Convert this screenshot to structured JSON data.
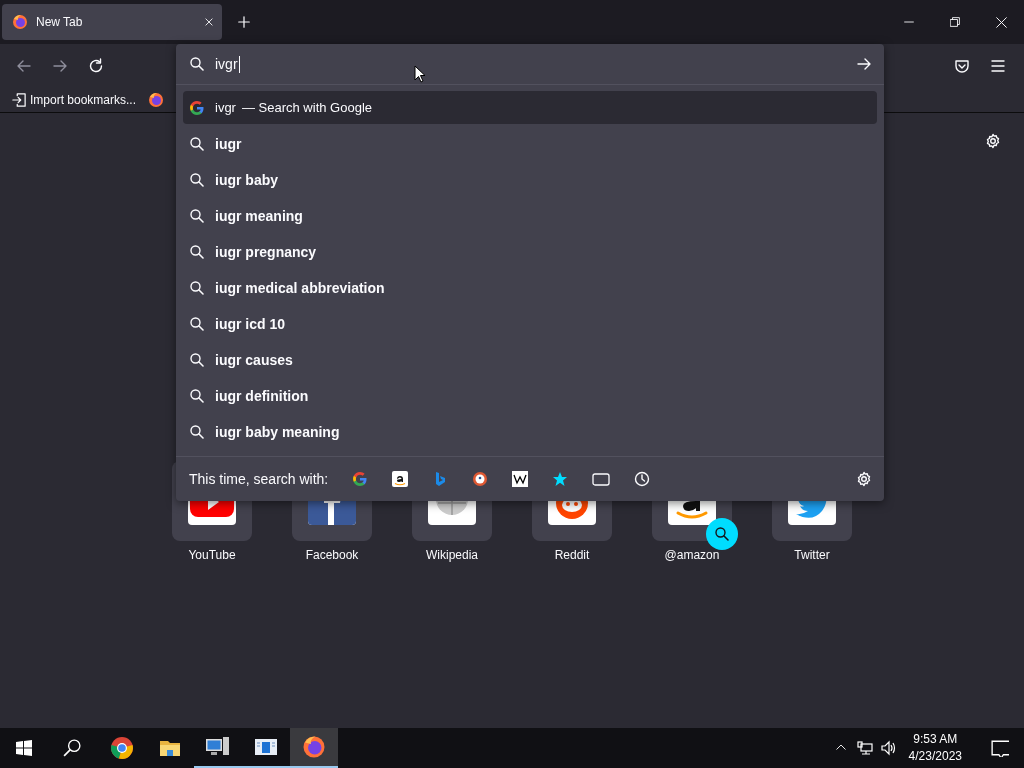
{
  "tab": {
    "title": "New Tab",
    "selected": true
  },
  "bookmarks": [
    {
      "label": "Import bookmarks..."
    }
  ],
  "urlbar": {
    "value": "ivgr"
  },
  "results": [
    {
      "kind": "engine",
      "query": "ivgr",
      "action": "— Search with Google",
      "selected": true
    },
    {
      "kind": "suggestion",
      "text": "iugr",
      "selected": false
    },
    {
      "kind": "suggestion",
      "text": "iugr baby",
      "selected": false
    },
    {
      "kind": "suggestion",
      "text": "iugr meaning",
      "selected": false
    },
    {
      "kind": "suggestion",
      "text": "iugr pregnancy",
      "selected": false
    },
    {
      "kind": "suggestion",
      "text": "iugr medical abbreviation",
      "selected": false
    },
    {
      "kind": "suggestion",
      "text": "iugr icd 10",
      "selected": false
    },
    {
      "kind": "suggestion",
      "text": "iugr causes",
      "selected": false
    },
    {
      "kind": "suggestion",
      "text": "iugr definition",
      "selected": false
    },
    {
      "kind": "suggestion",
      "text": "iugr baby meaning",
      "selected": false
    }
  ],
  "search_with": {
    "label": "This time, search with:"
  },
  "top_sites": [
    {
      "label": "YouTube",
      "kind": "youtube"
    },
    {
      "label": "Facebook",
      "kind": "facebook"
    },
    {
      "label": "Wikipedia",
      "kind": "wikipedia"
    },
    {
      "label": "Reddit",
      "kind": "reddit"
    },
    {
      "label": "@amazon",
      "kind": "amazon"
    },
    {
      "label": "Twitter",
      "kind": "twitter"
    }
  ],
  "taskbar": {
    "time": "9:53 AM",
    "date": "4/23/2023"
  }
}
